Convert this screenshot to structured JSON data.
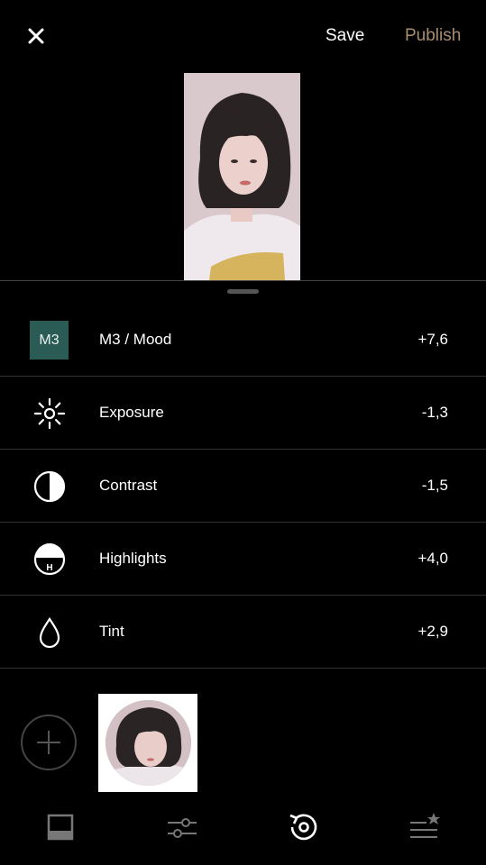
{
  "header": {
    "save_label": "Save",
    "publish_label": "Publish"
  },
  "adjustments": [
    {
      "icon": "preset-badge",
      "badge": "M3",
      "label": "M3 / Mood",
      "value": "+7,6"
    },
    {
      "icon": "sun-icon",
      "label": "Exposure",
      "value": "-1,3"
    },
    {
      "icon": "contrast-icon",
      "label": "Contrast",
      "value": "-1,5"
    },
    {
      "icon": "highlights-icon",
      "badge": "H",
      "label": "Highlights",
      "value": "+4,0"
    },
    {
      "icon": "drop-icon",
      "label": "Tint",
      "value": "+2,9"
    }
  ],
  "colors": {
    "accent_publish": "#a88d6e",
    "preset_badge": "#2b5b55",
    "background": "#000000"
  },
  "nav": [
    "presets-icon",
    "tools-icon",
    "history-icon",
    "recipes-icon"
  ]
}
